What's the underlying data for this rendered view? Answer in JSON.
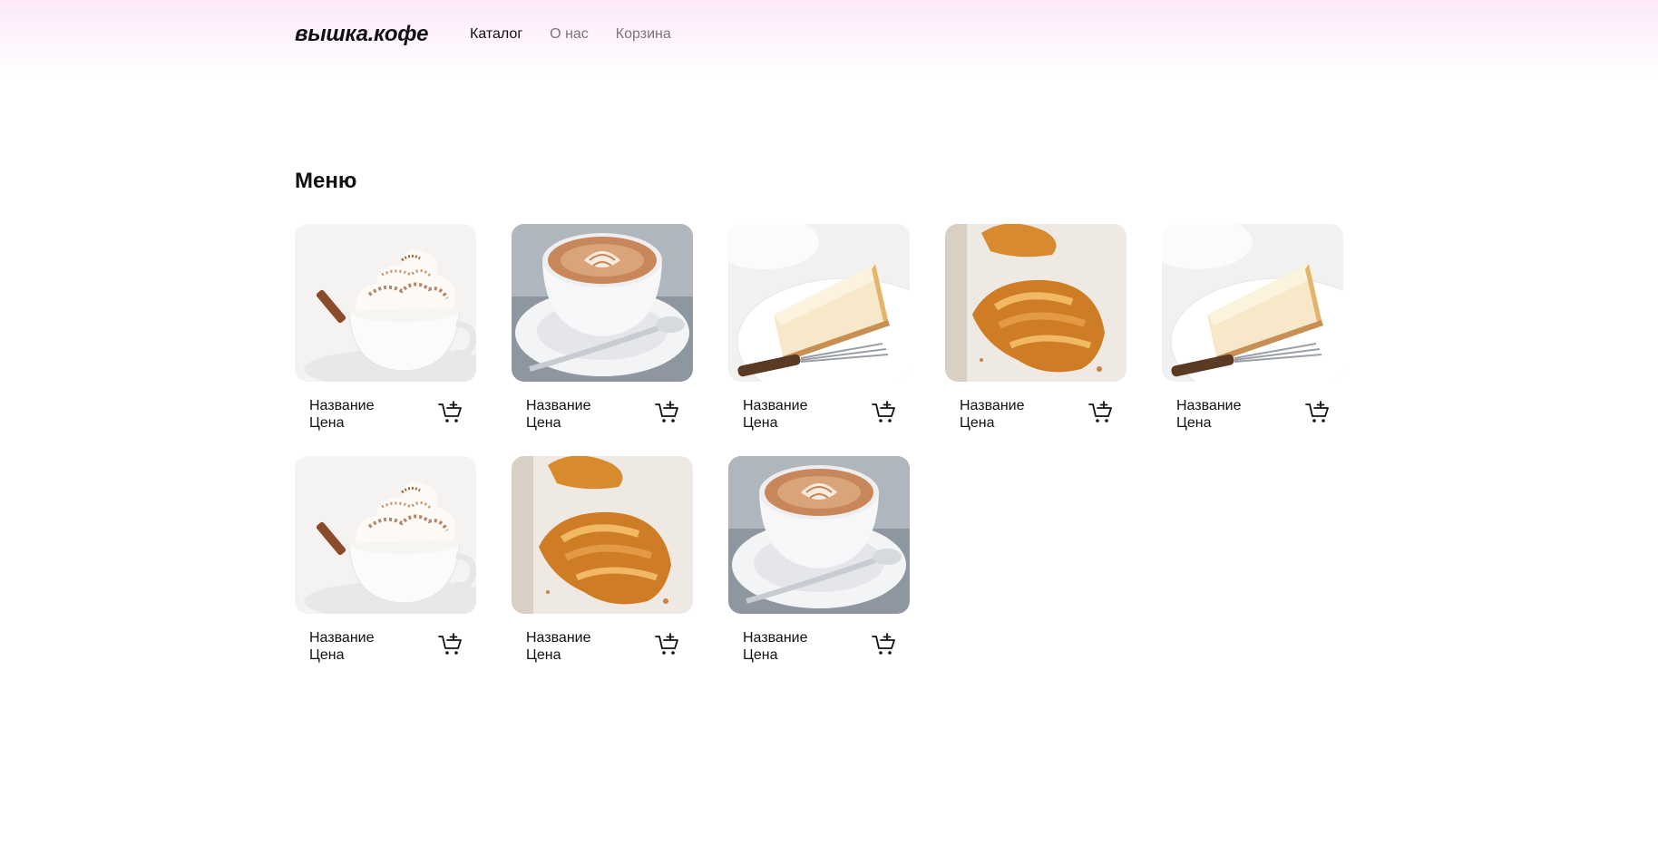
{
  "header": {
    "logo": "вышка.кофе",
    "nav": [
      {
        "label": "Каталог",
        "active": true
      },
      {
        "label": "О нас",
        "active": false
      },
      {
        "label": "Корзина",
        "active": false
      }
    ]
  },
  "menu": {
    "title": "Меню",
    "items": [
      {
        "name": "Название",
        "price": "Цена",
        "image": "whipped-cream-coffee-photo",
        "cart_icon": "add-to-cart-icon"
      },
      {
        "name": "Название",
        "price": "Цена",
        "image": "latte-art-cup-photo",
        "cart_icon": "add-to-cart-icon"
      },
      {
        "name": "Название",
        "price": "Цена",
        "image": "cheesecake-slice-photo",
        "cart_icon": "add-to-cart-icon"
      },
      {
        "name": "Название",
        "price": "Цена",
        "image": "croissant-photo",
        "cart_icon": "add-to-cart-icon"
      },
      {
        "name": "Название",
        "price": "Цена",
        "image": "cheesecake-slice-photo",
        "cart_icon": "add-to-cart-icon"
      },
      {
        "name": "Название",
        "price": "Цена",
        "image": "whipped-cream-coffee-photo",
        "cart_icon": "add-to-cart-icon"
      },
      {
        "name": "Название",
        "price": "Цена",
        "image": "croissant-photo",
        "cart_icon": "add-to-cart-icon"
      },
      {
        "name": "Название",
        "price": "Цена",
        "image": "latte-art-cup-photo",
        "cart_icon": "add-to-cart-icon"
      }
    ]
  },
  "colors": {
    "header_gradient_top": "#fde9fb",
    "text_primary": "#111111",
    "nav_inactive": "#777777"
  }
}
